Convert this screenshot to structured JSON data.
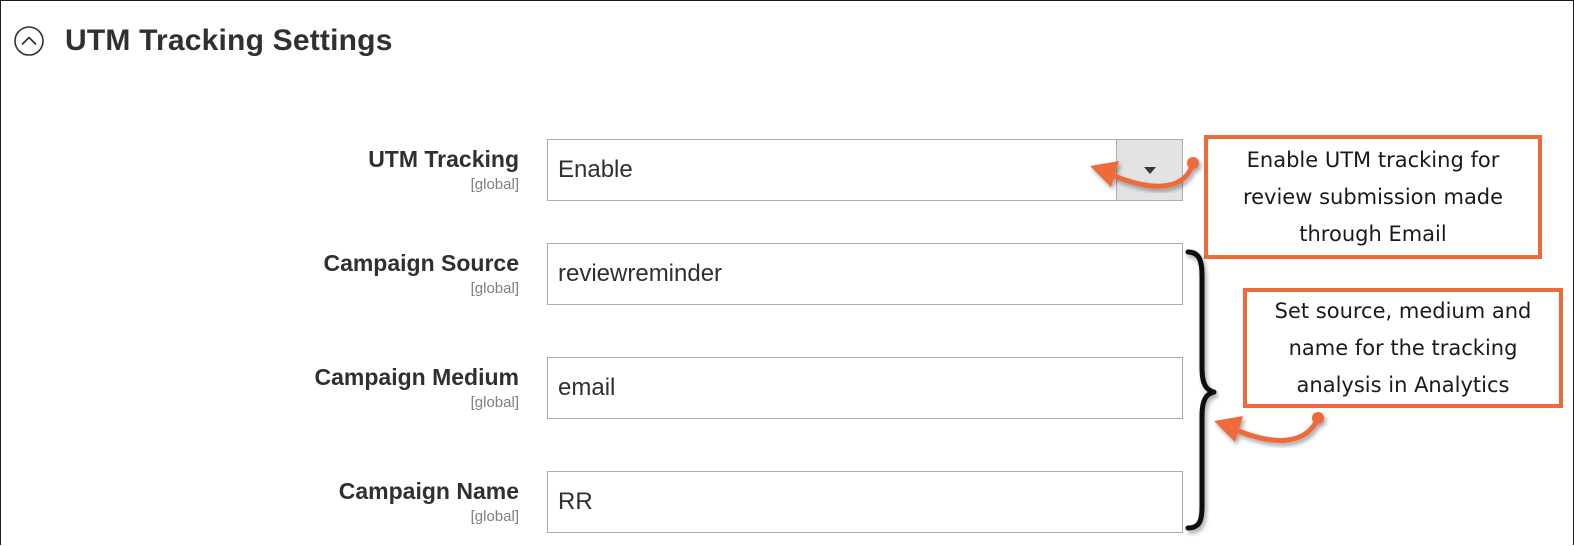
{
  "section": {
    "title": "UTM Tracking Settings",
    "toggle_icon": "chevron-up-circle-icon"
  },
  "fields": {
    "utm_tracking": {
      "label": "UTM Tracking",
      "scope": "[global]",
      "value": "Enable",
      "arrow_icon": "triangle-down-icon"
    },
    "campaign_source": {
      "label": "Campaign Source",
      "scope": "[global]",
      "value": "reviewreminder"
    },
    "campaign_medium": {
      "label": "Campaign Medium",
      "scope": "[global]",
      "value": "email"
    },
    "campaign_name": {
      "label": "Campaign Name",
      "scope": "[global]",
      "value": "RR"
    }
  },
  "annotations": {
    "callout_1": "Enable UTM tracking for\nreview submission made\nthrough Email",
    "callout_2": "Set source, medium and\nname for the tracking\nanalysis in Analytics",
    "accent_color": "#ee6a3a",
    "arrow_icon": "curved-arrow-icon",
    "bracket_icon": "curly-brace-icon"
  }
}
